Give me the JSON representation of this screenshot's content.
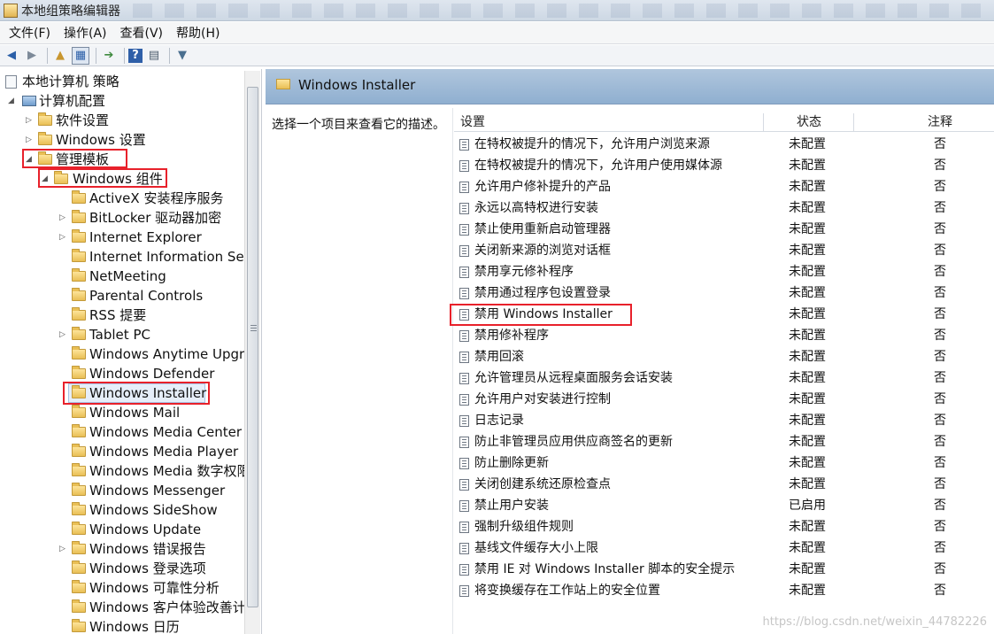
{
  "window": {
    "title": "本地组策略编辑器"
  },
  "menu": [
    "文件(F)",
    "操作(A)",
    "查看(V)",
    "帮助(H)"
  ],
  "toolbar": {
    "buttons": [
      "back-icon",
      "forward-icon",
      "up-folder-icon",
      "show-hide-tree-icon",
      "export-list-icon",
      "help-icon",
      "properties-icon",
      "filter-icon"
    ]
  },
  "tree": {
    "root": "本地计算机 策略",
    "computer_config": "计算机配置",
    "software_settings": "软件设置",
    "windows_settings": "Windows 设置",
    "admin_templates": "管理模板",
    "windows_components": "Windows 组件",
    "components": [
      "ActiveX 安装程序服务",
      "BitLocker 驱动器加密",
      "Internet Explorer",
      "Internet Information Ser",
      "NetMeeting",
      "Parental Controls",
      "RSS 提要",
      "Tablet PC",
      "Windows Anytime Upgr",
      "Windows Defender",
      "Windows Installer",
      "Windows Mail",
      "Windows Media Center",
      "Windows Media Player",
      "Windows Media 数字权限",
      "Windows Messenger",
      "Windows SideShow",
      "Windows Update",
      "Windows 错误报告",
      "Windows 登录选项",
      "Windows 可靠性分析",
      "Windows 客户体验改善计",
      "Windows 日历"
    ]
  },
  "right": {
    "title": "Windows Installer",
    "description": "选择一个项目来查看它的描述。",
    "columns": {
      "setting": "设置",
      "state": "状态",
      "note": "注释"
    },
    "settings": [
      {
        "name": "在特权被提升的情况下，允许用户浏览来源",
        "state": "未配置",
        "note": "否"
      },
      {
        "name": "在特权被提升的情况下，允许用户使用媒体源",
        "state": "未配置",
        "note": "否"
      },
      {
        "name": "允许用户修补提升的产品",
        "state": "未配置",
        "note": "否"
      },
      {
        "name": "永远以高特权进行安装",
        "state": "未配置",
        "note": "否"
      },
      {
        "name": "禁止使用重新启动管理器",
        "state": "未配置",
        "note": "否"
      },
      {
        "name": "关闭新来源的浏览对话框",
        "state": "未配置",
        "note": "否"
      },
      {
        "name": "禁用享元修补程序",
        "state": "未配置",
        "note": "否"
      },
      {
        "name": "禁用通过程序包设置登录",
        "state": "未配置",
        "note": "否"
      },
      {
        "name": "禁用 Windows Installer",
        "state": "未配置",
        "note": "否"
      },
      {
        "name": "禁用修补程序",
        "state": "未配置",
        "note": "否"
      },
      {
        "name": "禁用回滚",
        "state": "未配置",
        "note": "否"
      },
      {
        "name": "允许管理员从远程桌面服务会话安装",
        "state": "未配置",
        "note": "否"
      },
      {
        "name": "允许用户对安装进行控制",
        "state": "未配置",
        "note": "否"
      },
      {
        "name": "日志记录",
        "state": "未配置",
        "note": "否"
      },
      {
        "name": "防止非管理员应用供应商签名的更新",
        "state": "未配置",
        "note": "否"
      },
      {
        "name": "防止删除更新",
        "state": "未配置",
        "note": "否"
      },
      {
        "name": "关闭创建系统还原检查点",
        "state": "未配置",
        "note": "否"
      },
      {
        "name": "禁止用户安装",
        "state": "已启用",
        "note": "否"
      },
      {
        "name": "强制升级组件规则",
        "state": "未配置",
        "note": "否"
      },
      {
        "name": "基线文件缓存大小上限",
        "state": "未配置",
        "note": "否"
      },
      {
        "name": "禁用 IE 对 Windows Installer 脚本的安全提示",
        "state": "未配置",
        "note": "否"
      },
      {
        "name": "将变换缓存在工作站上的安全位置",
        "state": "未配置",
        "note": "否"
      }
    ]
  },
  "watermark": "https://blog.csdn.net/weixin_44782226",
  "colors": {
    "highlight": "#e8212b",
    "header_blue": "#9fb9d6"
  }
}
